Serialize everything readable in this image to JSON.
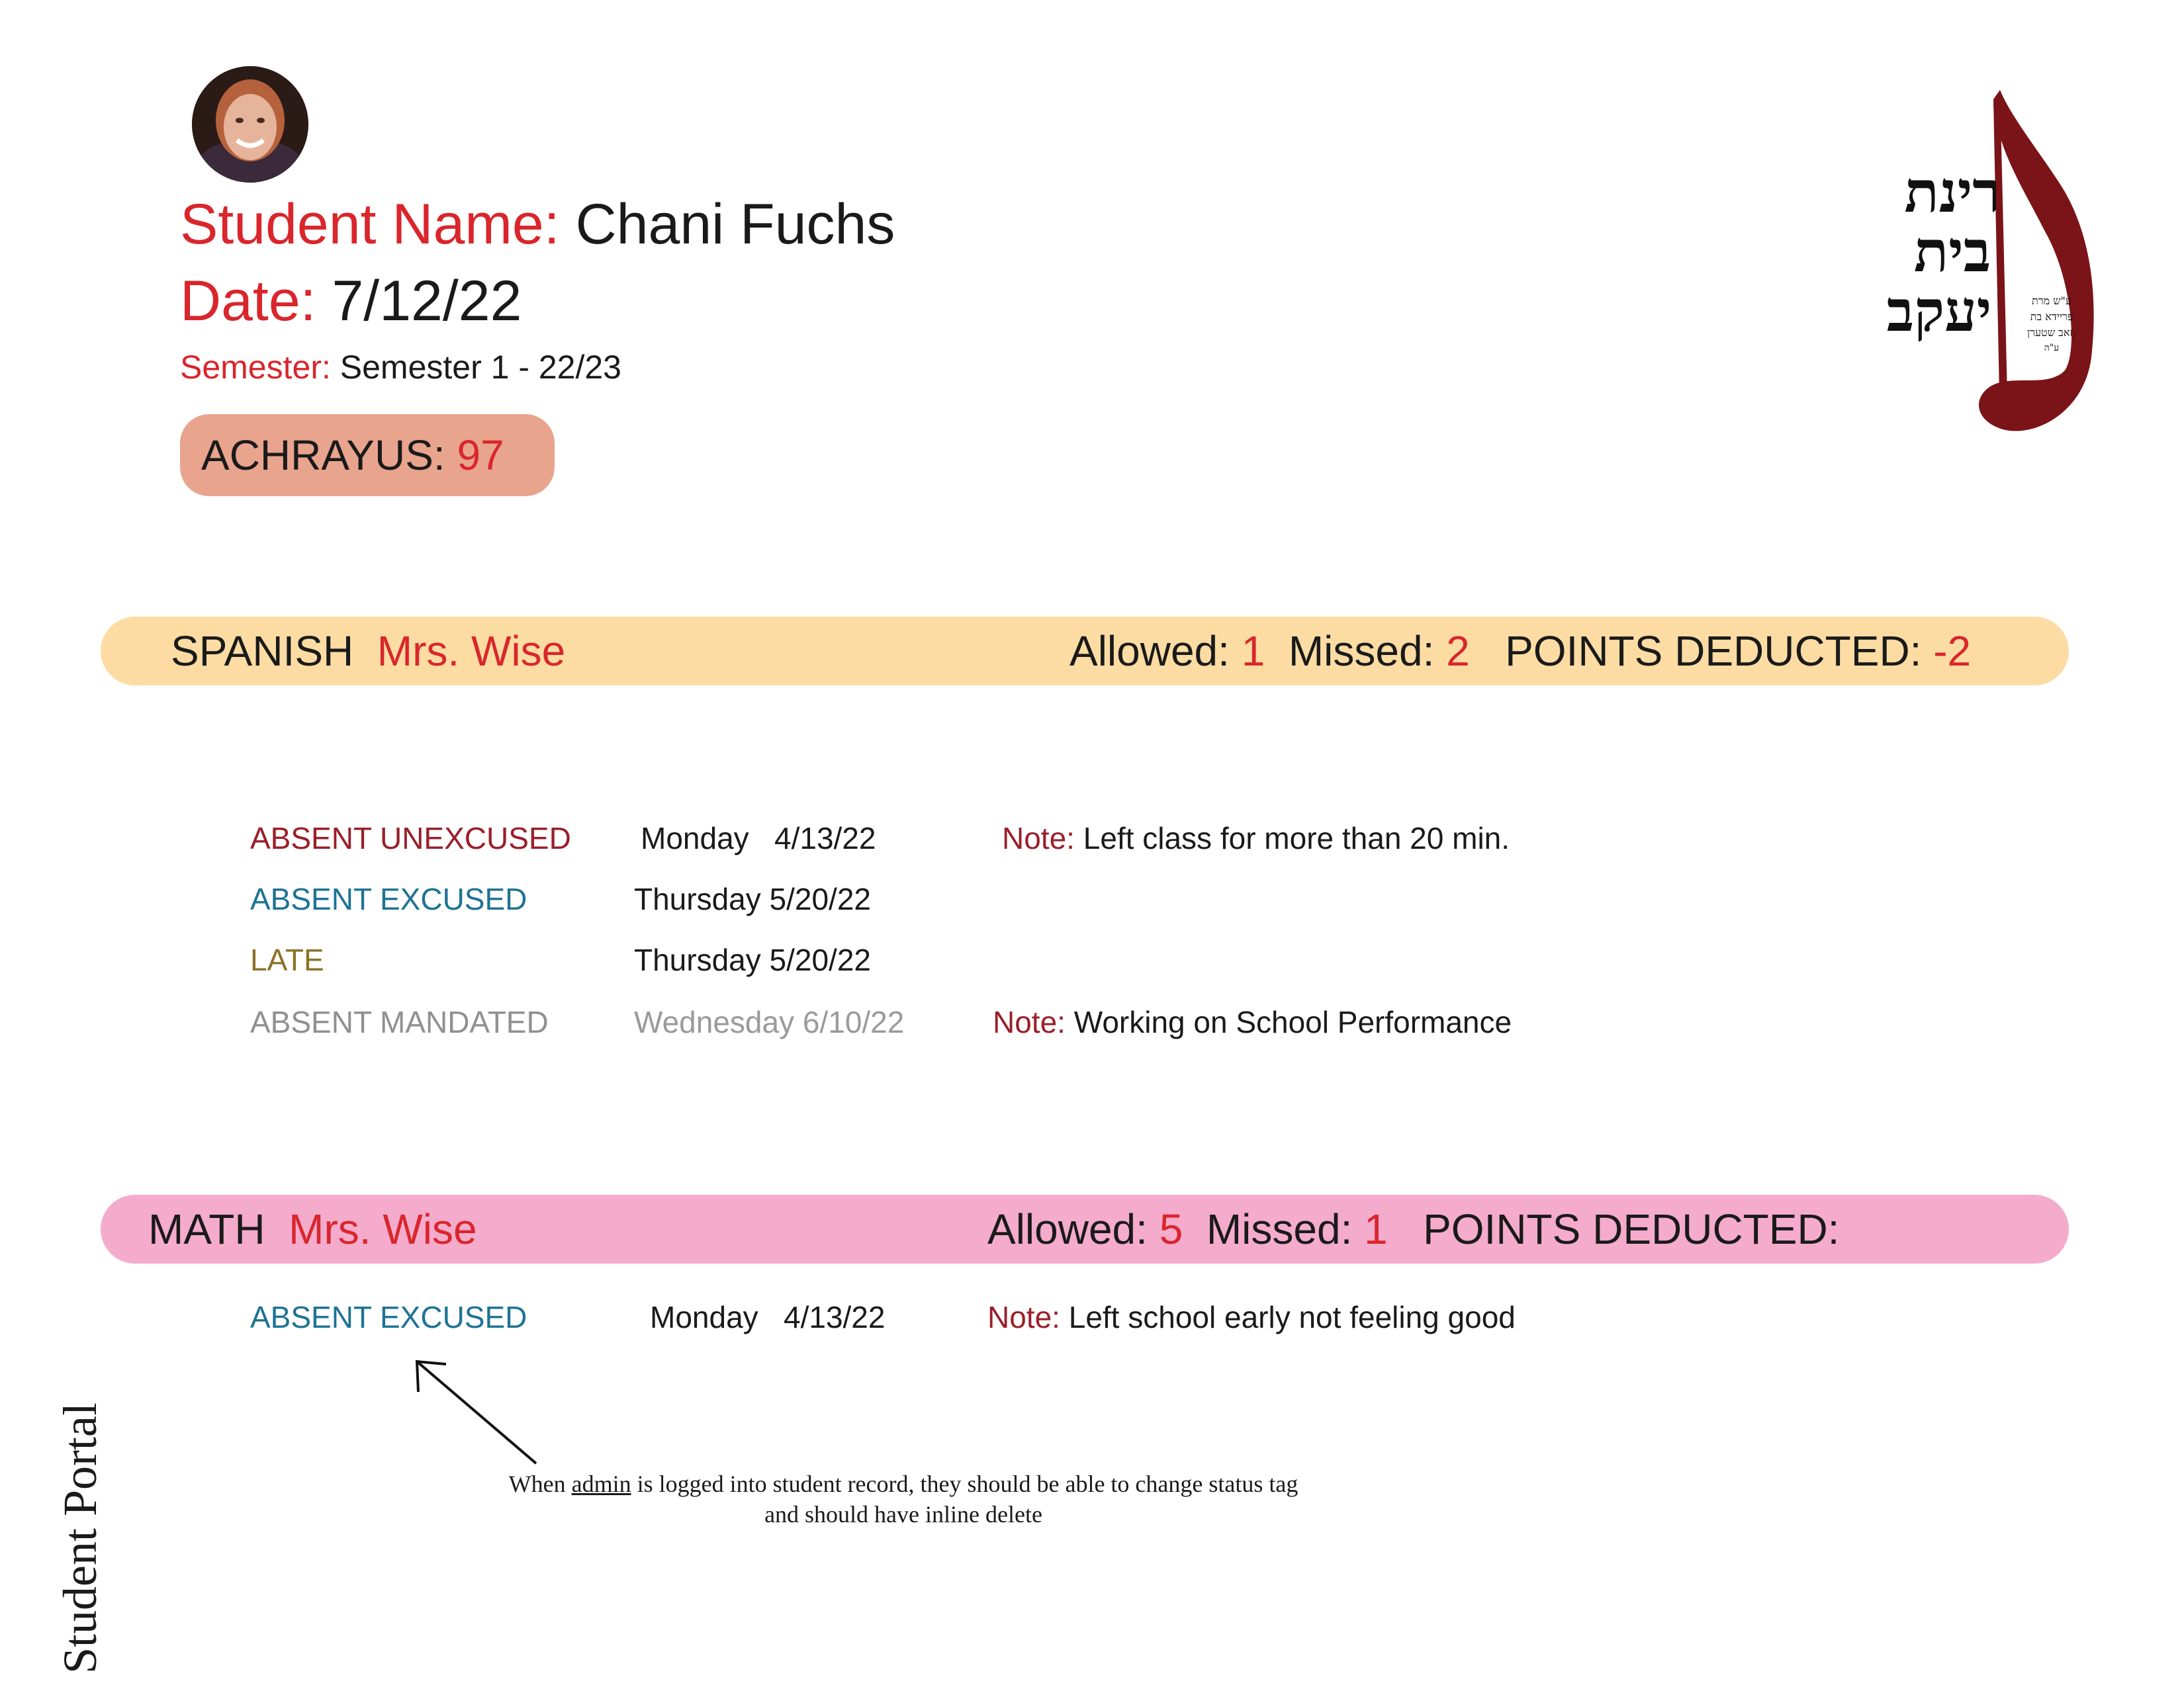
{
  "student": {
    "name_label": "Student Name:",
    "name": "Chani Fuchs",
    "date_label": "Date:",
    "date": "7/12/22",
    "semester_label": "Semester:",
    "semester": "Semester 1 - 22/23",
    "achrayus_label": "ACHRAYUS:",
    "achrayus_value": "97"
  },
  "logo": {
    "line1": "רינת",
    "line2": "בית",
    "line3": "יעקב",
    "dedication": [
      "ע\"ש מרת",
      "פריידא בת",
      "זאב שטערן,",
      "ע\"ה"
    ]
  },
  "subjects": [
    {
      "subject": "SPANISH",
      "teacher": "Mrs. Wise",
      "allowed_label": "Allowed:",
      "allowed": "1",
      "missed_label": "Missed:",
      "missed": "2",
      "points_label": "POINTS DEDUCTED:",
      "points": "-2",
      "color": "#fddca4",
      "records": [
        {
          "status": "ABSENT UNEXCUSED",
          "day": "Monday",
          "date": "4/13/22",
          "note_label": "Note:",
          "note": "Left class for more than 20 min."
        },
        {
          "status": "ABSENT EXCUSED",
          "day": "Thursday",
          "date": "5/20/22",
          "note_label": "",
          "note": ""
        },
        {
          "status": "LATE",
          "day": "Thursday",
          "date": "5/20/22",
          "note_label": "",
          "note": ""
        },
        {
          "status": "ABSENT MANDATED",
          "day": "Wednesday",
          "date": "6/10/22",
          "note_label": "Note:",
          "note": "Working on School Performance"
        }
      ]
    },
    {
      "subject": "MATH",
      "teacher": "Mrs. Wise",
      "allowed_label": "Allowed:",
      "allowed": "5",
      "missed_label": "Missed:",
      "missed": "1",
      "points_label": "POINTS DEDUCTED:",
      "points": "",
      "color": "#f4abcc",
      "records": [
        {
          "status": "ABSENT EXCUSED",
          "day": "Monday",
          "date": "4/13/22",
          "note_label": "Note:",
          "note": "Left school early not feeling good"
        }
      ]
    }
  ],
  "annotation": {
    "pre": "When",
    "underlined": "admin",
    "post": "is logged into student record, they should be able to change status tag",
    "line2": "and should have inline delete"
  },
  "portal_label": "Student Portal",
  "colors": {
    "accent_red": "#d9262c",
    "note_red": "#9a1f2a",
    "excused_blue": "#1e7394",
    "late_gold": "#8c7228",
    "mandated_gray": "#909090",
    "achrayus_bg": "#e9a48e",
    "logo_maroon": "#7a1418"
  }
}
